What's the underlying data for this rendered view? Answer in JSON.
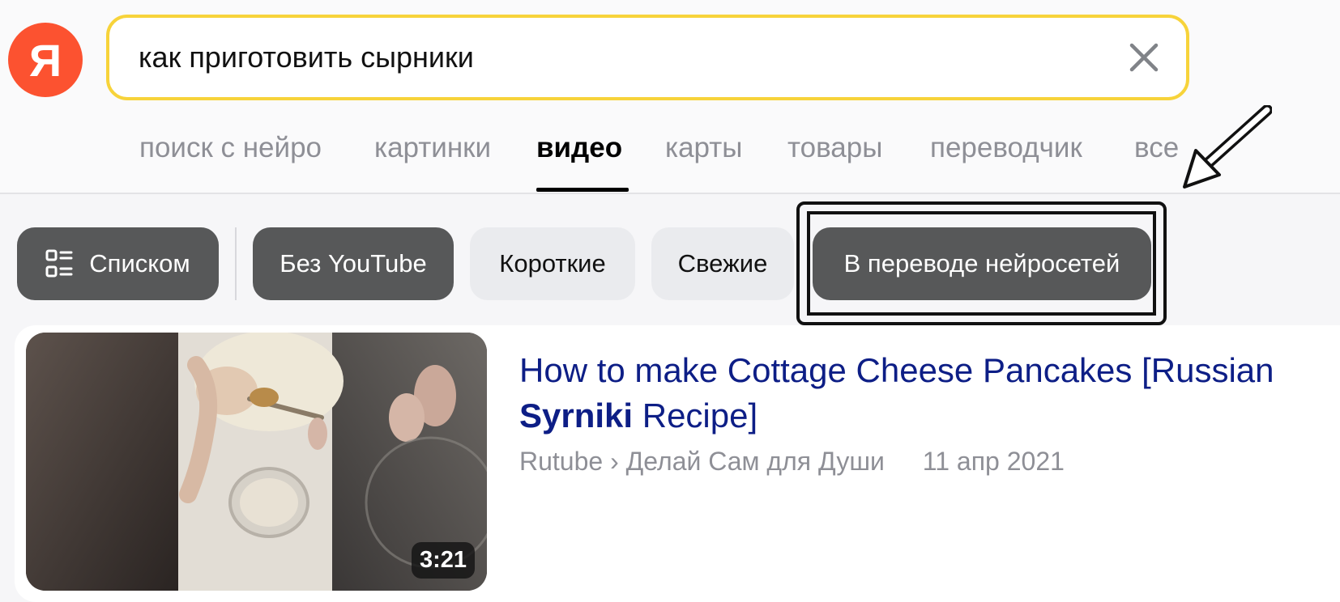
{
  "logo": {
    "text": "Я"
  },
  "search": {
    "value": "как приготовить сырники",
    "clear_icon": "close-icon"
  },
  "tabs": [
    {
      "label": "поиск с нейро",
      "active": false
    },
    {
      "label": "картинки",
      "active": false
    },
    {
      "label": "видео",
      "active": true
    },
    {
      "label": "карты",
      "active": false
    },
    {
      "label": "товары",
      "active": false
    },
    {
      "label": "переводчик",
      "active": false
    },
    {
      "label": "все",
      "active": false
    }
  ],
  "filters": {
    "list_view": {
      "label": "Списком",
      "icon": "list-view-icon"
    },
    "chips": [
      {
        "label": "Без YouTube",
        "style": "dark"
      },
      {
        "label": "Короткие",
        "style": "light"
      },
      {
        "label": "Свежие",
        "style": "light"
      },
      {
        "label": "В переводе нейросетей",
        "style": "dark"
      }
    ]
  },
  "result": {
    "title_before": "How to make Cottage Cheese Pancakes [Russian ",
    "title_bold": "Syrniki",
    "title_after": " Recipe]",
    "source": "Rutube",
    "separator": "›",
    "channel": "Делай Сам для Души",
    "date": "11 апр 2021",
    "duration": "3:21"
  },
  "colors": {
    "logo": "#fc5230",
    "search_border": "#f7d33a",
    "chip_dark": "#575859",
    "chip_light": "#eaebee",
    "title_link": "#0d1e86",
    "muted_text": "#8e8f96"
  }
}
